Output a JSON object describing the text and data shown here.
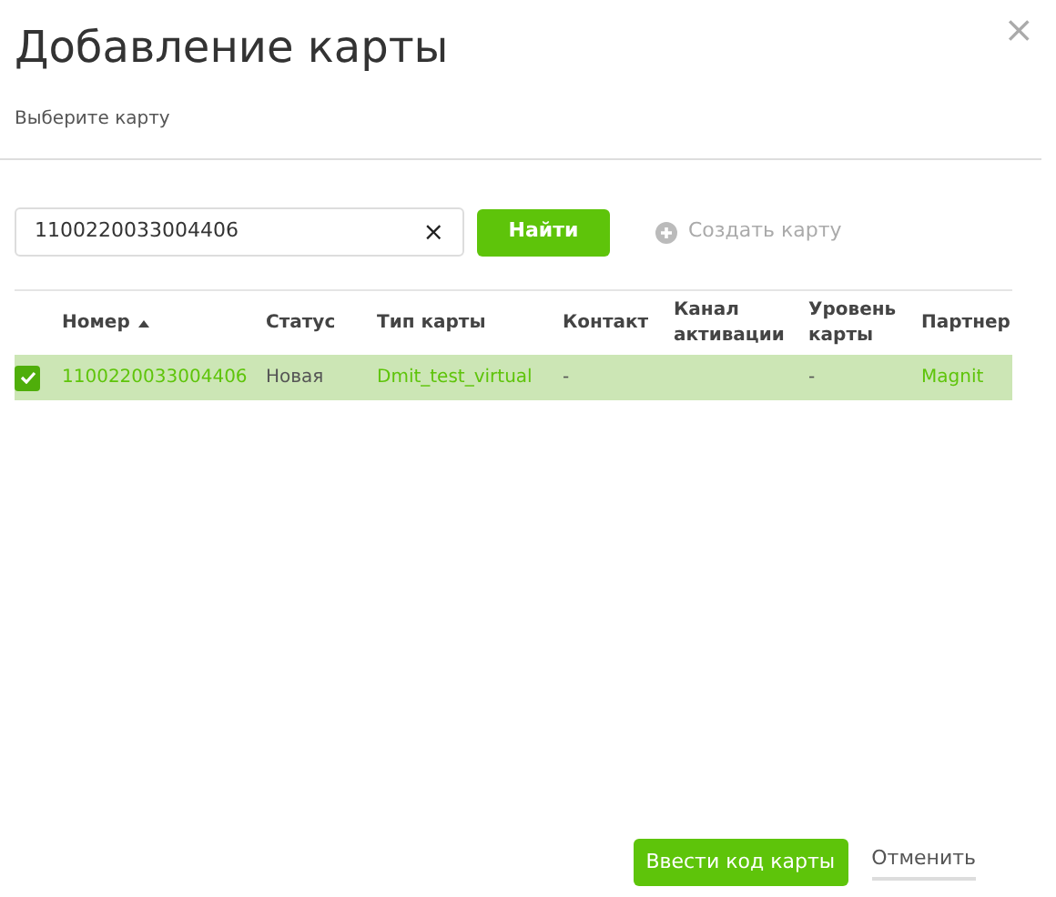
{
  "dialog": {
    "title": "Добавление карты",
    "subtitle": "Выберите карту",
    "close": "×"
  },
  "search": {
    "value": "1100220033004406",
    "clear": "×",
    "find_button": "Найти",
    "create_link": "Создать карту",
    "create_disabled": true
  },
  "table": {
    "columns": [
      {
        "label": "Номер",
        "sorted": true
      },
      {
        "label": "Статус",
        "sorted": false
      },
      {
        "label": "Тип карты",
        "sorted": false
      },
      {
        "label": "Контакт",
        "sorted": false
      },
      {
        "label": "Канал активации",
        "sorted": false
      },
      {
        "label": "Уровень карты",
        "sorted": false
      },
      {
        "label": "Партнер",
        "sorted": false
      }
    ],
    "rows": [
      {
        "selected": true,
        "cells": [
          {
            "text": "1100220033004406",
            "kind": "link"
          },
          {
            "text": "Новая",
            "kind": "text"
          },
          {
            "text": "Dmit_test_virtual",
            "kind": "link"
          },
          {
            "text": "-",
            "kind": "text"
          },
          {
            "kind": "empty"
          },
          {
            "text": "-",
            "kind": "text"
          },
          {
            "text": "Magnit",
            "kind": "link"
          }
        ]
      }
    ]
  },
  "footer": {
    "primary_button": "Ввести код карты",
    "cancel_button": "Отменить"
  }
}
